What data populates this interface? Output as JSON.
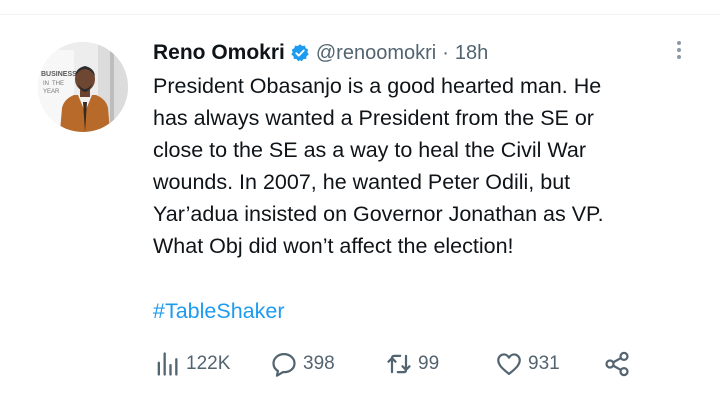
{
  "tweet": {
    "author": {
      "display_name": "Reno Omokri",
      "handle": "@renoomokri",
      "verified": true
    },
    "separator": "·",
    "time": "18h",
    "text_lines": [
      "President Obasanjo is a good hearted man. He",
      "has always wanted a President from the SE or",
      "close to the SE as a way to heal the Civil War",
      "wounds. In 2007, he wanted Peter Odili, but",
      "Yar’adua insisted on Governor Jonathan as VP.",
      "What Obj did won’t affect the election!"
    ],
    "hashtag": "#TableShaker",
    "stats": {
      "views": "122K",
      "replies": "398",
      "retweets": "99",
      "likes": "931"
    }
  },
  "avatar_sign_text": [
    "BUSINESS",
    "IN",
    "THE",
    "YEAR"
  ],
  "icons": [
    "verified-badge-icon",
    "more-options-icon",
    "views-icon",
    "reply-icon",
    "retweet-icon",
    "like-icon",
    "share-icon"
  ],
  "colors": {
    "text": "#0f1419",
    "secondary": "#536471",
    "link": "#1d9bf0",
    "verified": "#1d9bf0"
  }
}
